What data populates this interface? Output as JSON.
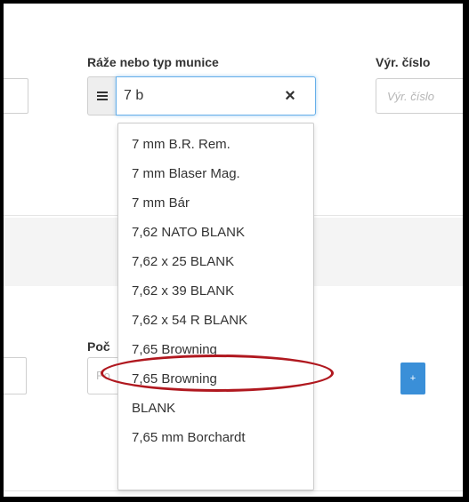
{
  "form": {
    "caliber_label": "Ráže nebo typ munice",
    "serial_label": "Výr. číslo",
    "serial_placeholder": "Výr. číslo",
    "search_value": "7 b",
    "clear_symbol": "×",
    "count_label": "Poč",
    "count_placeholder": "Po",
    "add_button_symbol": "+"
  },
  "dropdown": {
    "items": [
      "7 mm B.R. Rem.",
      "7 mm Blaser Mag.",
      "7 mm Bár",
      "7,62 NATO BLANK",
      "7,62 x 25 BLANK",
      "7,62 x 39 BLANK",
      "7,62 x 54 R BLANK",
      "7,65 Browning",
      "7,65 Browning",
      "BLANK",
      "7,65 mm Borchardt"
    ],
    "highlighted_index": 7
  },
  "colors": {
    "focus_border": "#66afe9",
    "highlight_ellipse": "#b0181f",
    "add_button": "#3a8fd8"
  }
}
